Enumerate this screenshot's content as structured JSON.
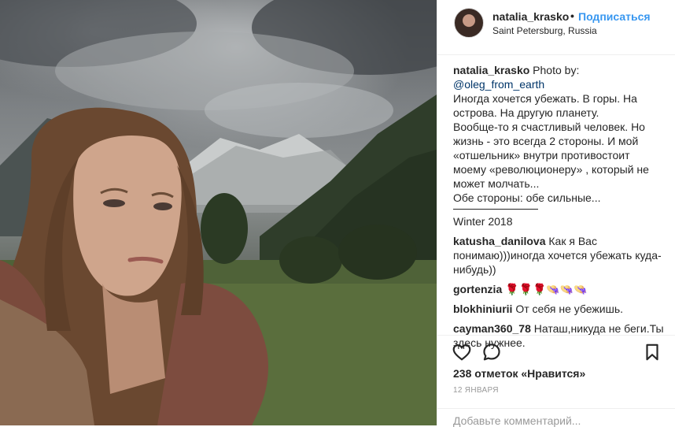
{
  "header": {
    "username": "natalia_krasko",
    "separator": "•",
    "follow_label": "Подписаться",
    "location": "Saint Petersburg, Russia"
  },
  "caption": {
    "author": "natalia_krasko",
    "intro": " Photo by:",
    "mention": "@oleg_from_earth",
    "lines": [
      "Иногда хочется убежать. В горы. На острова. На другую планету.",
      "Вообще-то я счастливый человек. Но жизнь - это всегда 2 стороны. И мой «отшельник» внутри противостоит моему «революционеру» , который не может молчать...",
      "Обе стороны: обе сильные..."
    ],
    "footer": "Winter 2018"
  },
  "comments": [
    {
      "user": "katusha_danilova",
      "text": " Как я Вас понимаю)))иногда хочется убежать куда-нибудь))"
    },
    {
      "user": "gortenzia",
      "text": " 🌹🌹🌹👒👒👒"
    },
    {
      "user": "blokhiniurii",
      "text": " От себя не убежишь."
    },
    {
      "user": "cayman360_78",
      "text": " Наташ,никуда не беги.Ты здесь нужнее."
    }
  ],
  "actions": {
    "like_icon": "heart-icon",
    "comment_icon": "comment-bubble-icon",
    "save_icon": "bookmark-icon",
    "likes_text": "238 отметок «Нравится»",
    "date": "12 ЯНВАРЯ"
  },
  "add_comment": {
    "placeholder": "Добавьте комментарий..."
  }
}
